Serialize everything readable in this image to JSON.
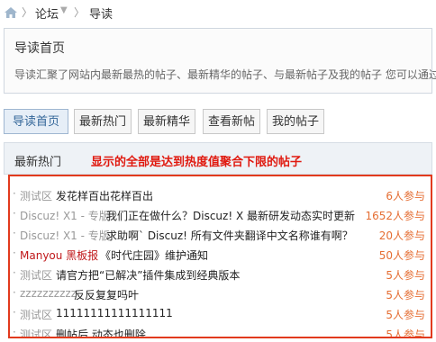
{
  "breadcrumb": {
    "forum": "论坛",
    "current": "导读"
  },
  "intro": {
    "title": "导读首页",
    "description": "导读汇聚了网站内最新最热的帖子、最新精华的帖子、与最新帖子及我的帖子 您可以通过"
  },
  "tabs": [
    {
      "label": "导读首页",
      "active": true
    },
    {
      "label": "最新热门",
      "active": false
    },
    {
      "label": "最新精华",
      "active": false
    },
    {
      "label": "查看新帖",
      "active": false
    },
    {
      "label": "我的帖子",
      "active": false
    }
  ],
  "panel": {
    "title": "最新热门",
    "note": "显示的全部是达到热度值聚合下限的帖子"
  },
  "threads": [
    {
      "forum": "测试区",
      "title": "发花样百出花样百出",
      "count": "6人参与",
      "forum_red": false
    },
    {
      "forum": "Discuz! X1 - 专版",
      "title": "我们正在做什么？Discuz! X 最新研发动态实时更新",
      "count": "1652人参与",
      "forum_red": false
    },
    {
      "forum": "Discuz! X1 - 专版",
      "title": "求助啊` Discuz! 所有文件夹翻译中文名称谁有啊？",
      "count": "20人参与",
      "forum_red": false
    },
    {
      "forum": "Manyou 黑板报",
      "title": "《时代庄园》维护通知",
      "count": "50人参与",
      "forum_red": true
    },
    {
      "forum": "测试区",
      "title": "请官方把“已解决”插件集成到经典版本",
      "count": "5人参与",
      "forum_red": false
    },
    {
      "forum": "zzzzzzzzzz",
      "title": "反反复复吗叶",
      "count": "5人参与",
      "forum_red": false
    },
    {
      "forum": "测试区",
      "title": "11111111111111111",
      "count": "5人参与",
      "forum_red": false
    },
    {
      "forum": "测试区",
      "title": "删帖后 动态也删除",
      "count": "5人参与",
      "forum_red": false
    }
  ],
  "colors": {
    "accent_red": "#e0190f",
    "count_orange": "#e56e33",
    "tab_active_bg": "#e6eef7"
  }
}
